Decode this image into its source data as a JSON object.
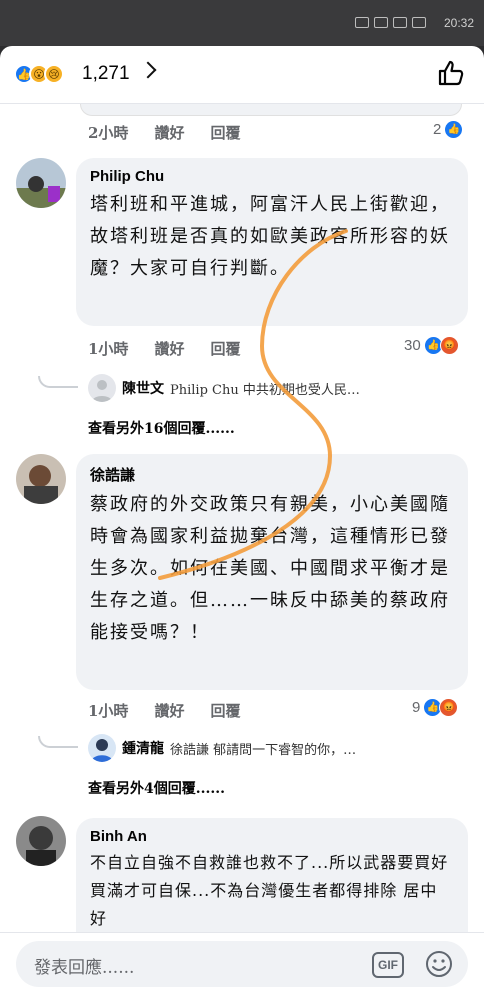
{
  "status_bar": {
    "time": "20:32"
  },
  "header": {
    "reactions": [
      "like",
      "wow",
      "sad"
    ],
    "reaction_count": "1,271",
    "reaction_glyphs": {
      "like": "👍",
      "wow": "😮",
      "sad": "😢"
    }
  },
  "top_meta": {
    "time": "2小時",
    "like": "讚好",
    "reply": "回覆",
    "count": "2"
  },
  "comments": [
    {
      "author": "Philip Chu",
      "text": "塔利班和平進城，阿富汗人民上街歡迎，故塔利班是否真的如歐美政客所形容的妖魔？大家可自行判斷。",
      "time": "1小時",
      "like": "讚好",
      "reply": "回覆",
      "count": "30",
      "reply_preview": {
        "name": "陳世文",
        "text": "Philip Chu 中共初期也受人民…"
      },
      "view_more": "查看另外16個回覆......"
    },
    {
      "author": "徐誥謙",
      "text": "蔡政府的外交政策只有親美，小心美國隨時會為國家利益拋棄台灣，這種情形已發生多次。如何在美國、中國間求平衡才是生存之道。但……一昧反中舔美的蔡政府能接受嗎？！",
      "time": "1小時",
      "like": "讚好",
      "reply": "回覆",
      "count": "9",
      "reply_preview": {
        "name": "鍾清龍",
        "text": "徐誥謙 郁請問一下睿智的你，…"
      },
      "view_more": "查看另外4個回覆......"
    },
    {
      "author": "Binh An",
      "text": "不自立自強不自救誰也救不了...所以武器要買好買滿才可自保...不為台灣優生者都得排除 居中好"
    }
  ],
  "composer": {
    "placeholder": "發表回應......",
    "gif_label": "GIF"
  },
  "colors": {
    "accent": "#1877f2",
    "bubble": "#f0f2f5",
    "scribble": "#f39c3c"
  }
}
